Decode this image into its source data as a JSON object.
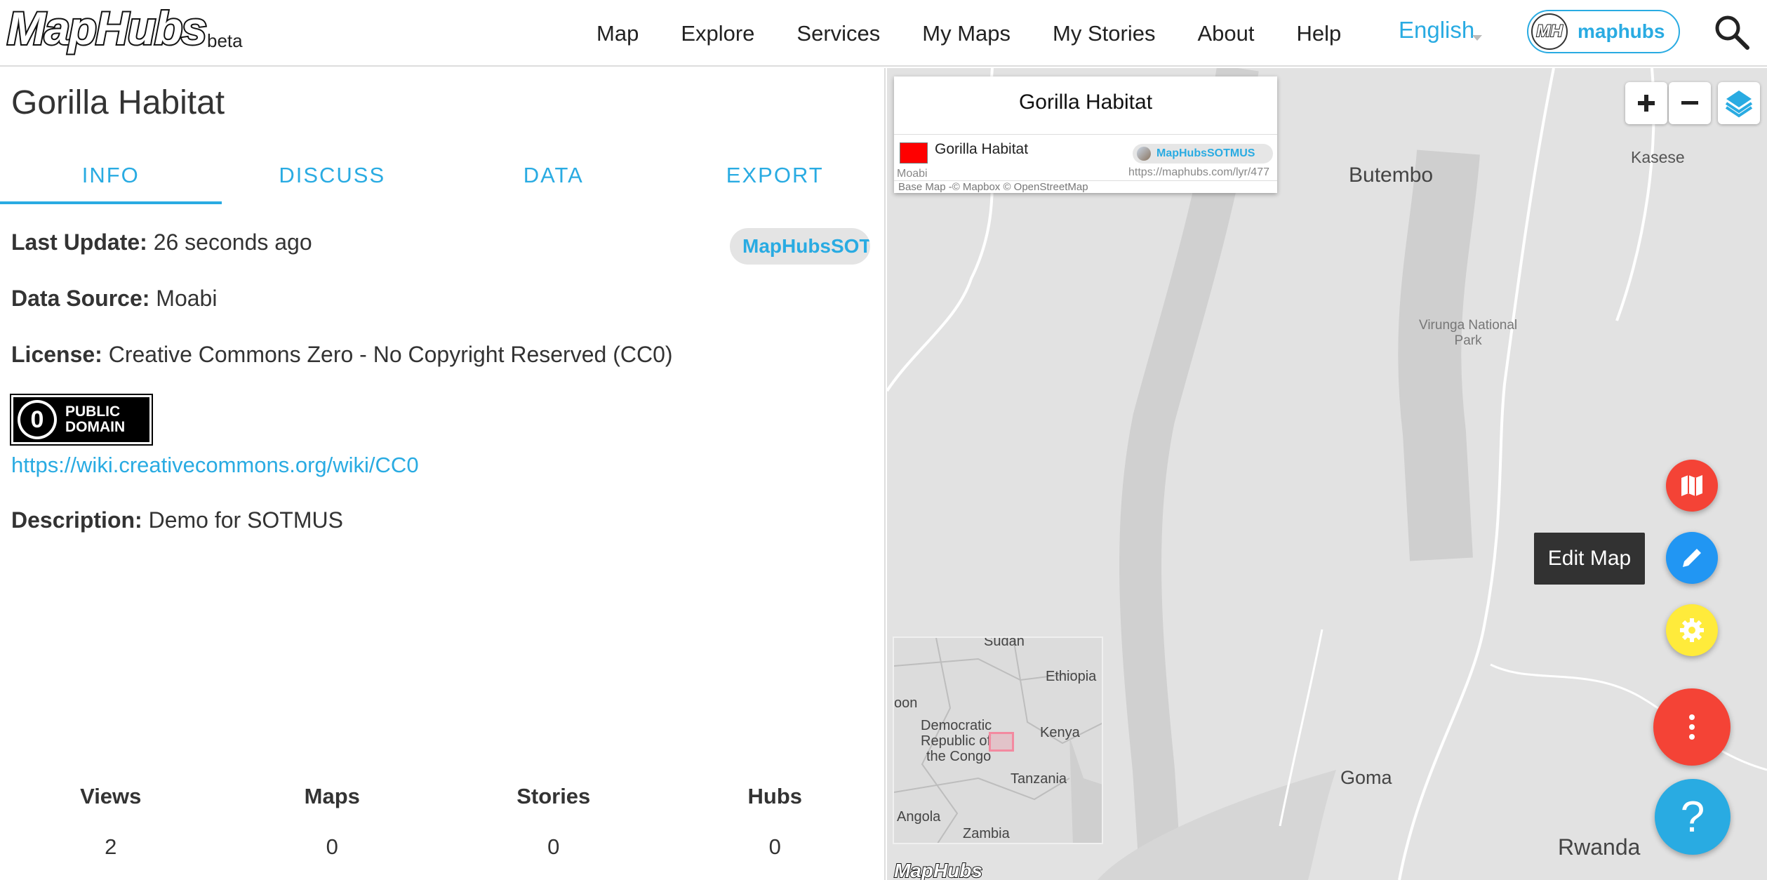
{
  "header": {
    "logo_text": "MapHubs",
    "beta_label": "beta",
    "nav": [
      "Map",
      "Explore",
      "Services",
      "My Maps",
      "My Stories",
      "About",
      "Help"
    ],
    "language": "English",
    "user_avatar_text": "MH",
    "user_name": "maphubs",
    "search_icon": "search-icon"
  },
  "layer": {
    "title": "Gorilla Habitat",
    "tabs": [
      "INFO",
      "DISCUSS",
      "DATA",
      "EXPORT"
    ],
    "active_tab": "INFO",
    "last_update_label": "Last Update:",
    "last_update_value": "26 seconds ago",
    "owner_name": "MapHubsSOTMUS",
    "data_source_label": "Data Source:",
    "data_source_value": "Moabi",
    "license_label": "License:",
    "license_value": "Creative Commons Zero - No Copyright Reserved (CC0)",
    "cc_badge_text_1": "PUBLIC",
    "cc_badge_text_2": "DOMAIN",
    "license_link": "https://wiki.creativecommons.org/wiki/CC0",
    "description_label": "Description:",
    "description_value": "Demo for SOTMUS"
  },
  "stats": {
    "labels": [
      "Views",
      "Maps",
      "Stories",
      "Hubs"
    ],
    "values": [
      "2",
      "0",
      "0",
      "0"
    ]
  },
  "map": {
    "legend_title": "Gorilla Habitat",
    "legend_layer_name": "Gorilla Habitat",
    "legend_swatch_color": "#ff0000",
    "legend_source": "Moabi",
    "legend_owner": "MapHubsSOTMUS",
    "legend_url": "https://maphubs.com/lyr/477",
    "attribution": "Base Map -© Mapbox © OpenStreetMap",
    "places": {
      "butembo": "Butembo",
      "kasese": "Kasese",
      "virunga_1": "Virunga National",
      "virunga_2": "Park",
      "goma": "Goma",
      "rwanda": "Rwanda"
    },
    "minimap_labels": {
      "sudan": "Sudan",
      "ethiopia": "Ethiopia",
      "oon": "oon",
      "drc_1": "Democratic",
      "drc_2": "Republic of",
      "drc_3": "the Congo",
      "kenya": "Kenya",
      "tanzania": "Tanzania",
      "angola": "Angola",
      "zambia": "Zambia"
    },
    "map_logo": "MapHubs",
    "tooltip": "Edit Map",
    "fab_colors": {
      "map": "#f44336",
      "edit": "#2196f3",
      "settings": "#ffeb3b",
      "more": "#f44336",
      "help": "#29abe2"
    }
  }
}
